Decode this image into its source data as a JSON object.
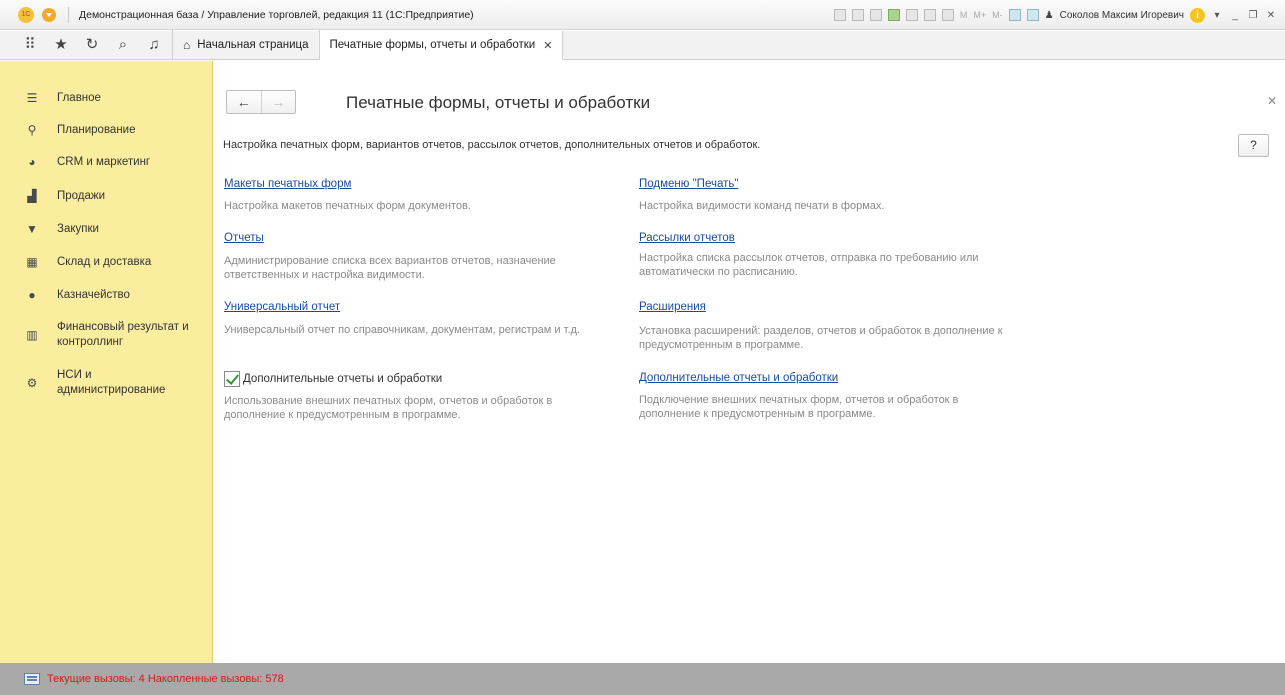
{
  "titlebar": {
    "logo": "1C",
    "title": "Демонстрационная база / Управление торговлей, редакция 11  (1С:Предприятие)",
    "memory_buttons": [
      "M",
      "M+",
      "M-"
    ],
    "user": "Соколов Максим Игоревич"
  },
  "tabs": {
    "home": "Начальная страница",
    "active": "Печатные формы, отчеты и обработки"
  },
  "sidebar": {
    "items": [
      {
        "label": "Главное",
        "icon": "menu-icon"
      },
      {
        "label": "Планирование",
        "icon": "planning-icon"
      },
      {
        "label": "CRM и маркетинг",
        "icon": "pie-chart-icon"
      },
      {
        "label": "Продажи",
        "icon": "bag-icon"
      },
      {
        "label": "Закупки",
        "icon": "cart-icon"
      },
      {
        "label": "Склад и доставка",
        "icon": "warehouse-icon"
      },
      {
        "label": "Казначейство",
        "icon": "coin-icon"
      },
      {
        "label": "Финансовый результат и контроллинг",
        "icon": "bar-chart-icon"
      },
      {
        "label": "НСИ и администрирование",
        "icon": "gear-icon"
      }
    ]
  },
  "content": {
    "title": "Печатные формы, отчеты и обработки",
    "description": "Настройка печатных форм, вариантов отчетов, рассылок отчетов, дополнительных отчетов и обработок.",
    "help": "?",
    "left": [
      {
        "link": "Макеты печатных форм",
        "note": "Настройка макетов печатных форм документов."
      },
      {
        "link": "Отчеты",
        "note": "Администрирование списка всех вариантов отчетов, назначение ответственных и настройка видимости."
      },
      {
        "link": "Универсальный отчет",
        "note": "Универсальный отчет по справочникам, документам, регистрам и т.д."
      }
    ],
    "checkbox": {
      "label": "Дополнительные отчеты и обработки",
      "checked": true,
      "note": "Использование внешних печатных форм, отчетов и обработок в дополнение к предусмотренным в программе."
    },
    "right": [
      {
        "link": "Подменю \"Печать\"",
        "note": "Настройка видимости команд печати в формах."
      },
      {
        "link": "Рассылки отчетов",
        "note": "Настройка списка рассылок отчетов, отправка по требованию или автоматически по расписанию."
      },
      {
        "link": "Расширения",
        "note": "Установка расширений: разделов, отчетов и обработок в дополнение к предусмотренным в программе."
      },
      {
        "link": "Дополнительные отчеты и обработки",
        "note": "Подключение внешних печатных форм, отчетов и обработок в дополнение к предусмотренным в программе."
      }
    ]
  },
  "statusbar": {
    "text": "Текущие вызовы: 4   Накопленные вызовы: 578"
  }
}
